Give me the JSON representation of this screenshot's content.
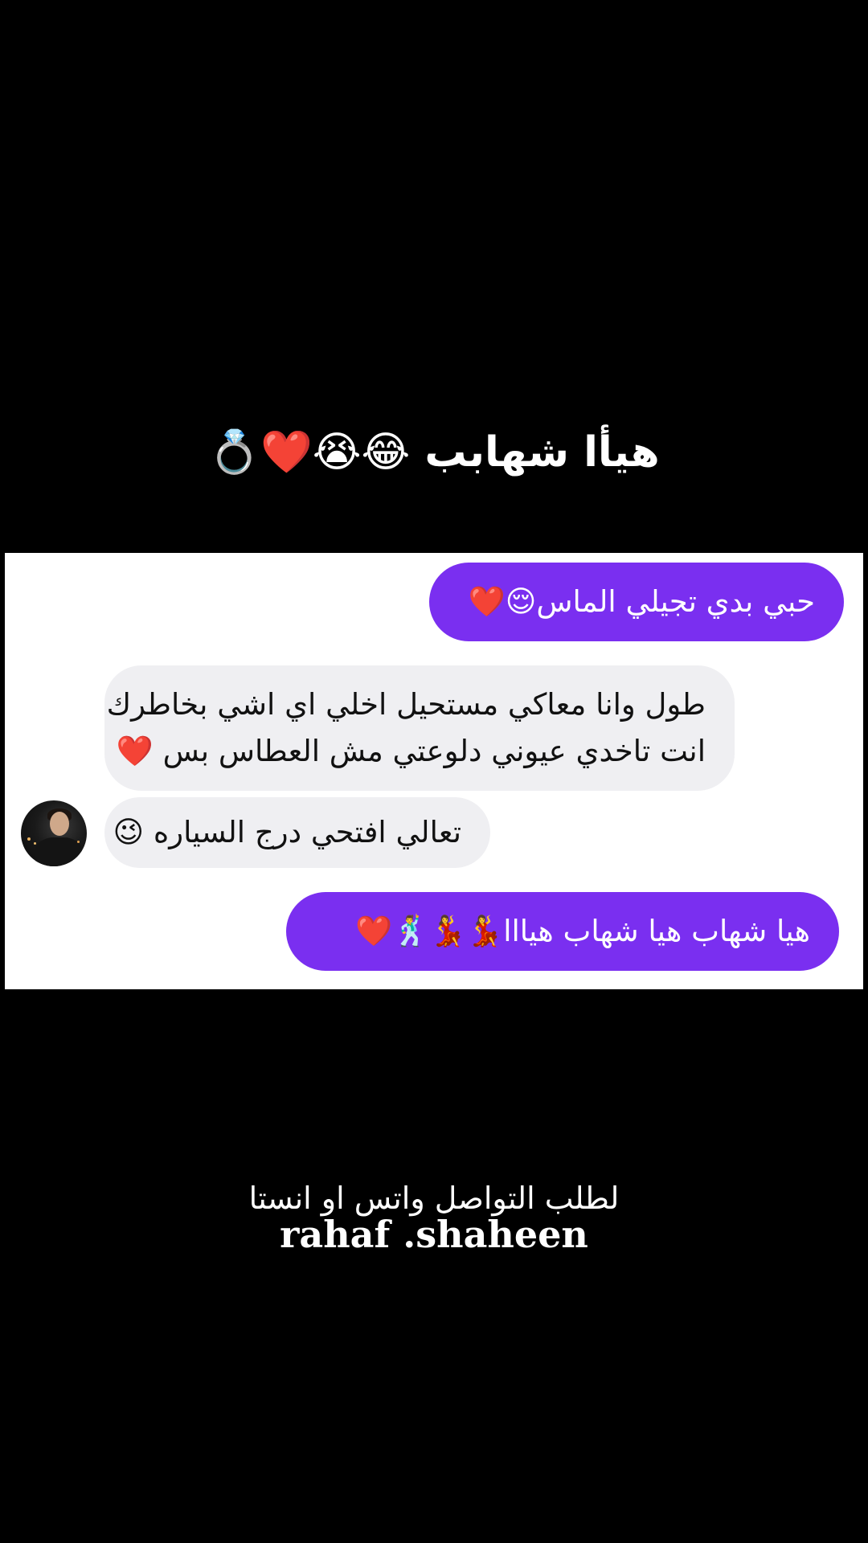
{
  "caption": {
    "title": "هيأا شهابب 😂😭❤️💍"
  },
  "chat": {
    "messages": [
      {
        "direction": "sent",
        "text": "حبي بدي تجيلي الماس😌❤️"
      },
      {
        "direction": "received",
        "lines": [
          "طول وانا معاكي مستحيل اخلي اي اشي بخاطرك",
          "انت تاخدي عيوني دلوعتي مش العطاس بس ❤️"
        ]
      },
      {
        "direction": "received",
        "text": "تعالي افتحي درج السياره 😉"
      },
      {
        "direction": "sent",
        "text": "هيا شهاب هيا شهاب هيااا💃💃🕺❤️"
      }
    ],
    "colors": {
      "sent_bubble": "#7a2ff0",
      "received_bubble": "#efeff2",
      "panel": "#ffffff"
    }
  },
  "footer": {
    "contact_text": "لطلب التواصل واتس او انستا",
    "handle": "rahaf .shaheen"
  }
}
